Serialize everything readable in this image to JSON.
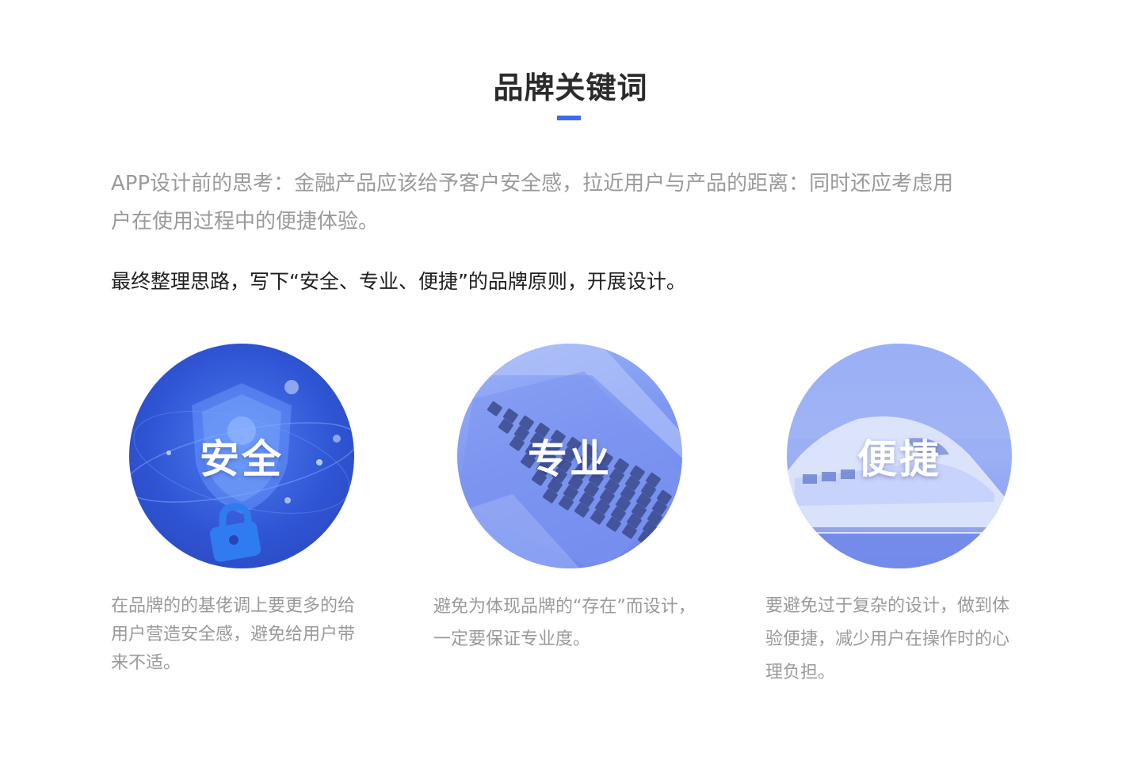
{
  "header": {
    "title": "品牌关键词"
  },
  "intro": {
    "lines": [
      "APP设计前的思考：金融产品应该给予客户安全感，拉近用户与产品的距离：同时还应考虑用",
      "户在使用过程中的便捷体验。"
    ]
  },
  "statement": "最终整理思路，写下“安全、专业、便捷”的品牌原则，开展设计。",
  "colors": {
    "accent": "#3d6bf0",
    "title": "#2b2b2b",
    "body_gray": "#9a9a9a",
    "body_dark": "#1f1f1f"
  },
  "cards": [
    {
      "label": "安全",
      "image_icon": "shield-lock-icon",
      "desc_lines": [
        "在品牌的的基佬调上要更多的给",
        "用户营造安全感，避免给用户带",
        "来不适。"
      ]
    },
    {
      "label": "专业",
      "image_icon": "laptop-keyboard-icon",
      "desc_lines": [
        "避免为体现品牌的“存在”而设计，",
        "一定要保证专业度。"
      ]
    },
    {
      "label": "便捷",
      "image_icon": "high-speed-train-icon",
      "desc_lines": [
        "要避免过于复杂的设计，做到体",
        "验便捷，减少用户在操作时的心",
        "理负担。"
      ]
    }
  ]
}
